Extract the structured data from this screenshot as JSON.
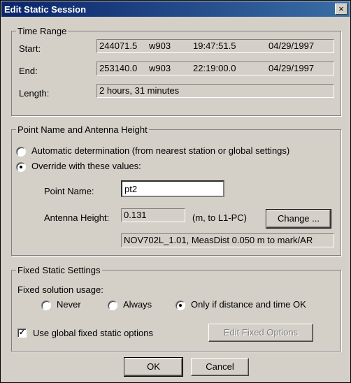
{
  "dialog": {
    "title": "Edit Static Session",
    "close_glyph": "×"
  },
  "time_range": {
    "legend": "Time Range",
    "start": {
      "label": "Start:",
      "epoch": "244071.5",
      "week": "w903",
      "time": "19:47:51.5",
      "date": "04/29/1997"
    },
    "end": {
      "label": "End:",
      "epoch": "253140.0",
      "week": "w903",
      "time": "22:19:00.0",
      "date": "04/29/1997"
    },
    "length": {
      "label": "Length:",
      "value": "2 hours, 31 minutes"
    }
  },
  "point_antenna": {
    "legend": "Point Name and Antenna Height",
    "automatic_label": "Automatic determination (from nearest station or global settings)",
    "override_label": "Override with these values:",
    "selected": "override",
    "point_name_label": "Point Name:",
    "point_name_value": "pt2",
    "antenna_height_label": "Antenna Height:",
    "antenna_height_value": "0.131",
    "antenna_unit": "(m, to L1-PC)",
    "change_button": "Change ...",
    "antenna_info": "NOV702L_1.01, MeasDist 0.050 m to mark/AR"
  },
  "fixed_static": {
    "legend": "Fixed Static Settings",
    "usage_label": "Fixed solution usage:",
    "never_label": "Never",
    "always_label": "Always",
    "only_if_label": "Only if distance and time OK",
    "selected": "only_if",
    "use_global_label": "Use global fixed static options",
    "use_global_checked": true,
    "check_glyph": "✓",
    "edit_fixed_button": "Edit Fixed Options"
  },
  "footer": {
    "ok_button": "OK",
    "cancel_button": "Cancel"
  }
}
